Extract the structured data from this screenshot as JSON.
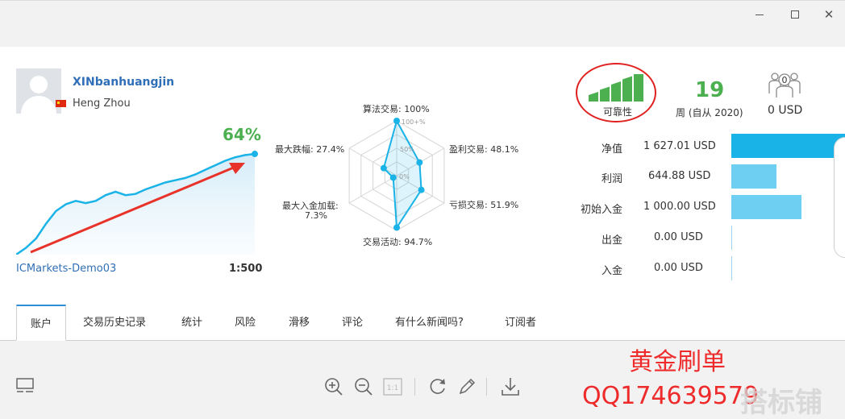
{
  "profile": {
    "username": "XINbanhuangjin",
    "location": "Heng Zhou"
  },
  "growth": {
    "percent": "64%",
    "server": "ICMarkets-Demo03",
    "leverage": "1:500"
  },
  "chart_data": [
    {
      "type": "line",
      "title": "",
      "values": [
        0,
        6,
        14,
        27,
        38,
        44,
        47,
        45,
        47,
        52,
        55,
        52,
        53,
        57,
        60,
        63,
        65,
        67,
        70,
        74,
        78,
        82,
        85,
        87,
        88
      ],
      "annotation": "64%",
      "grid": false,
      "legend": "none"
    },
    {
      "type": "radar",
      "title": "",
      "axes": [
        "算法交易",
        "盈利交易",
        "亏损交易",
        "交易活动",
        "最大入金加载",
        "最大跌幅"
      ],
      "values": [
        100,
        48.1,
        51.9,
        94.7,
        7.3,
        27.4
      ],
      "range": [
        0,
        100
      ],
      "ring_labels": [
        "0%",
        "50%",
        "100+%"
      ]
    }
  ],
  "radar_labels": {
    "algo": "算法交易: 100%",
    "profit": "盈利交易: 48.1%",
    "loss": "亏损交易: 51.9%",
    "activity": "交易活动: 94.7%",
    "deposit_a": "最大入金加载:",
    "deposit_b": "7.3%",
    "drawdown": "最大跌幅: 27.4%",
    "ring0": "0%",
    "ring50": "50%",
    "ring100": "100+%"
  },
  "reliability": {
    "label": "可靠性",
    "level": 1.0
  },
  "weeks": {
    "value": "19",
    "label": "周 (自从 2020)"
  },
  "subscribers": {
    "count": "0",
    "price": "0 USD"
  },
  "stats": [
    {
      "label": "净值",
      "value": "1 627.01 USD",
      "fraction": 1.0
    },
    {
      "label": "利润",
      "value": "644.88 USD",
      "fraction": 0.396
    },
    {
      "label": "初始入金",
      "value": "1 000.00 USD",
      "fraction": 0.615
    },
    {
      "label": "出金",
      "value": "0.00 USD",
      "fraction": 0
    },
    {
      "label": "入金",
      "value": "0.00 USD",
      "fraction": 0
    }
  ],
  "colors": {
    "accent": "#1ab3e8",
    "bar_light": "#6fcff3",
    "positive": "#4caf50",
    "link": "#2f6fb7",
    "watermark": "#ee2a2a"
  },
  "tabs": [
    "账户",
    "交易历史记录",
    "统计",
    "风险",
    "滑移",
    "评论",
    "有什么新闻吗?",
    "订阅者"
  ],
  "toolbar": {
    "zoom_reset": "1:1"
  },
  "watermark": {
    "line1": "黄金刷单",
    "line2": "QQ174639579",
    "overlay": "搭标铺"
  }
}
